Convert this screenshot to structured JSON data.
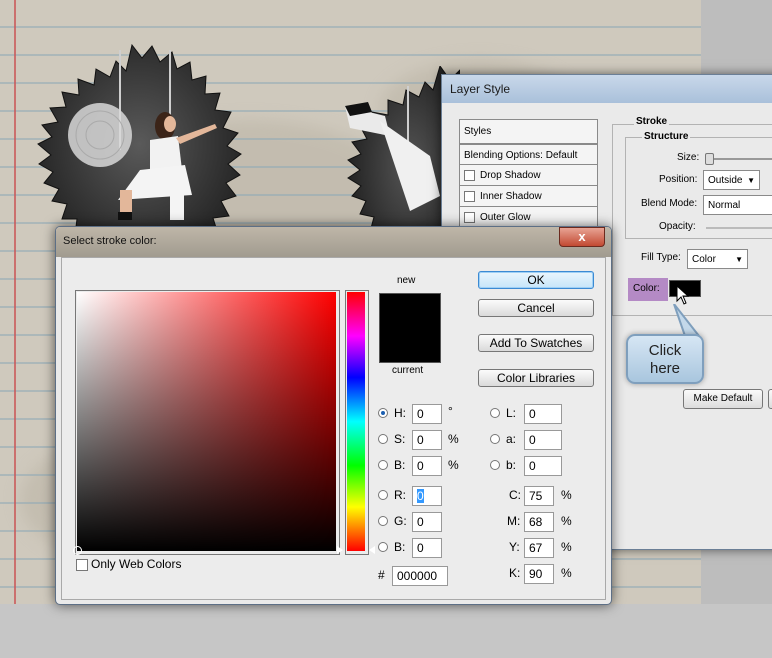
{
  "layer_style": {
    "title": "Layer Style",
    "styles_items": [
      {
        "label": "Styles",
        "checkbox": false
      },
      {
        "label": "Blending Options: Default",
        "checkbox": false
      },
      {
        "label": "Drop Shadow",
        "checkbox": true
      },
      {
        "label": "Inner Shadow",
        "checkbox": true
      },
      {
        "label": "Outer Glow",
        "checkbox": true
      }
    ],
    "section_title": "Stroke",
    "structure_title": "Structure",
    "size_label": "Size:",
    "position_label": "Position:",
    "position_value": "Outside",
    "blend_mode_label": "Blend Mode:",
    "blend_mode_value": "Normal",
    "opacity_label": "Opacity:",
    "fill_type_label": "Fill Type:",
    "fill_type_value": "Color",
    "color_label": "Color:",
    "color_value": "#000000",
    "make_default_label": "Make Default"
  },
  "callout": {
    "text_line1": "Click",
    "text_line2": "here"
  },
  "picker": {
    "title": "Select stroke color:",
    "close_symbol": "x",
    "new_label": "new",
    "current_label": "current",
    "ok_label": "OK",
    "cancel_label": "Cancel",
    "add_swatches_label": "Add To Swatches",
    "color_libraries_label": "Color Libraries",
    "only_web_colors_label": "Only Web Colors",
    "hsb": [
      {
        "label": "H:",
        "value": "0",
        "unit": "°",
        "selected": true
      },
      {
        "label": "S:",
        "value": "0",
        "unit": "%",
        "selected": false
      },
      {
        "label": "B:",
        "value": "0",
        "unit": "%",
        "selected": false
      }
    ],
    "rgb": [
      {
        "label": "R:",
        "value": "0"
      },
      {
        "label": "G:",
        "value": "0"
      },
      {
        "label": "B:",
        "value": "0"
      }
    ],
    "lab": [
      {
        "label": "L:",
        "value": "0"
      },
      {
        "label": "a:",
        "value": "0"
      },
      {
        "label": "b:",
        "value": "0"
      }
    ],
    "cmyk": [
      {
        "label": "C:",
        "value": "75",
        "unit": "%"
      },
      {
        "label": "M:",
        "value": "68",
        "unit": "%"
      },
      {
        "label": "Y:",
        "value": "67",
        "unit": "%"
      },
      {
        "label": "K:",
        "value": "90",
        "unit": "%"
      }
    ],
    "hex_label": "#",
    "hex_value": "000000",
    "new_color": "#000000",
    "current_color": "#000000"
  }
}
